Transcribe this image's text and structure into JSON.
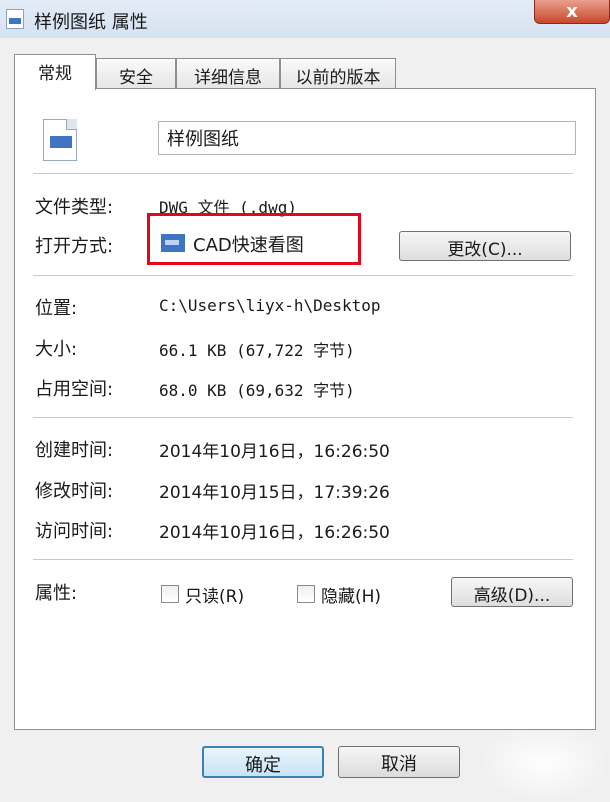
{
  "window": {
    "title": "样例图纸 属性",
    "close_label": "x"
  },
  "tabs": [
    {
      "label": "常规"
    },
    {
      "label": "安全"
    },
    {
      "label": "详细信息"
    },
    {
      "label": "以前的版本"
    }
  ],
  "general": {
    "file_name": "样例图纸",
    "file_type_label": "文件类型:",
    "file_type_value": "DWG 文件 (.dwg)",
    "open_with_label": "打开方式:",
    "open_with_value": "CAD快速看图",
    "change_button": "更改(C)...",
    "location_label": "位置:",
    "location_value": "C:\\Users\\liyx-h\\Desktop",
    "size_label": "大小:",
    "size_value": "66.1 KB (67,722 字节)",
    "size_on_disk_label": "占用空间:",
    "size_on_disk_value": "68.0 KB (69,632 字节)",
    "created_label": "创建时间:",
    "created_value": "2014年10月16日，16:26:50",
    "modified_label": "修改时间:",
    "modified_value": "2014年10月15日，17:39:26",
    "accessed_label": "访问时间:",
    "accessed_value": "2014年10月16日，16:26:50",
    "attributes_label": "属性:",
    "readonly_label": "只读(R)",
    "hidden_label": "隐藏(H)",
    "advanced_button": "高级(D)..."
  },
  "footer": {
    "ok": "确定",
    "cancel": "取消"
  },
  "icons": {
    "file": "dwg-file-icon",
    "app": "cad-app-icon",
    "title": "document-icon"
  },
  "colors": {
    "highlight_box": "#e3071b",
    "default_button_border": "#3c7fb1"
  }
}
